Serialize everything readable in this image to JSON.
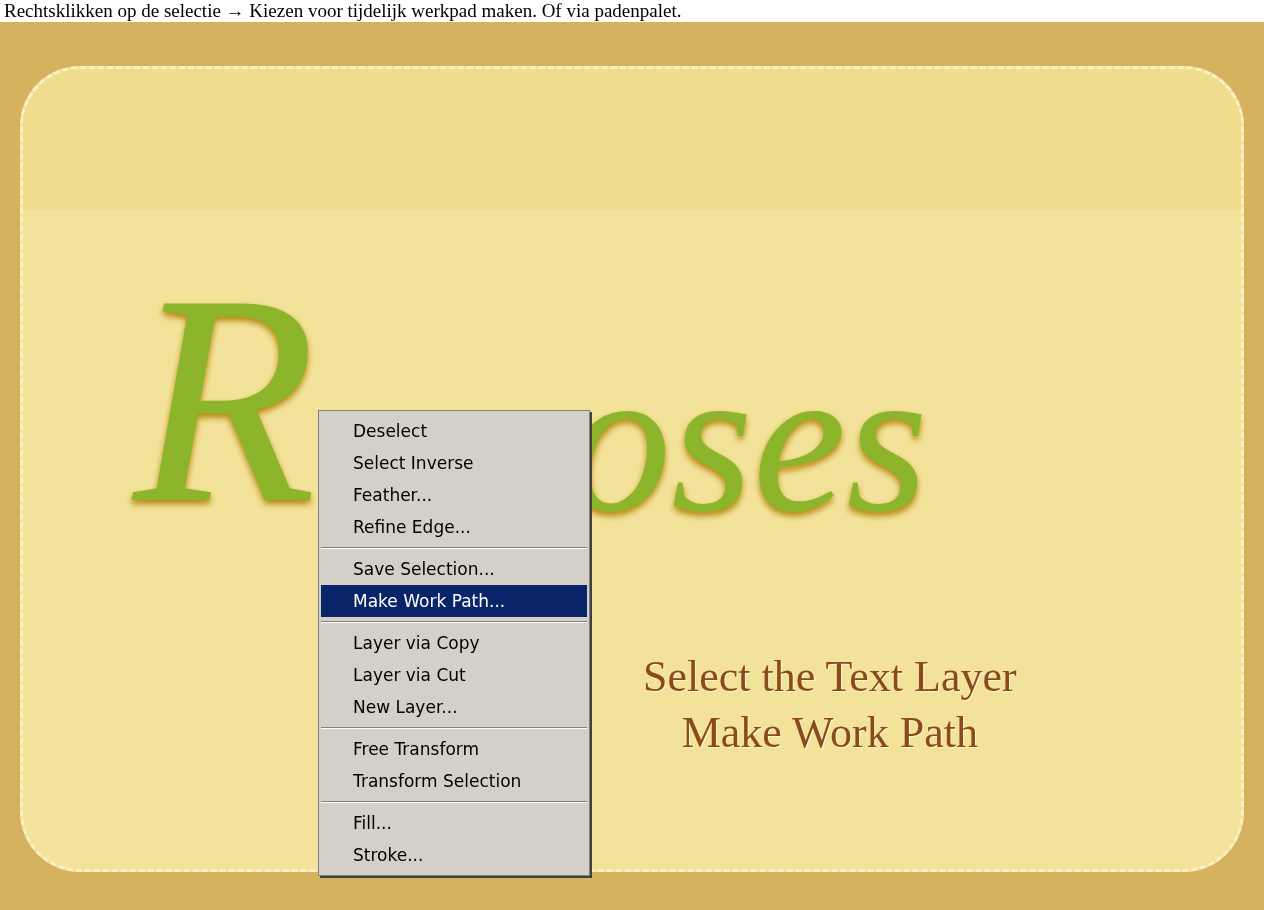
{
  "caption": "Rechtsklikken op de selectie → Kiezen voor tijdelijk werkpad maken. Of via padenpalet.",
  "canvas": {
    "title_letters": [
      "R",
      "oses"
    ],
    "instructions": [
      "Select the Text Layer",
      "Make Work Path"
    ]
  },
  "context_menu": {
    "items": [
      {
        "kind": "item",
        "label": "Deselect",
        "selected": false
      },
      {
        "kind": "item",
        "label": "Select Inverse",
        "selected": false
      },
      {
        "kind": "item",
        "label": "Feather...",
        "selected": false
      },
      {
        "kind": "item",
        "label": "Refine Edge...",
        "selected": false
      },
      {
        "kind": "separator"
      },
      {
        "kind": "item",
        "label": "Save Selection...",
        "selected": false
      },
      {
        "kind": "item",
        "label": "Make Work Path...",
        "selected": true
      },
      {
        "kind": "separator"
      },
      {
        "kind": "item",
        "label": "Layer via Copy",
        "selected": false
      },
      {
        "kind": "item",
        "label": "Layer via Cut",
        "selected": false
      },
      {
        "kind": "item",
        "label": "New Layer...",
        "selected": false
      },
      {
        "kind": "separator"
      },
      {
        "kind": "item",
        "label": "Free Transform",
        "selected": false
      },
      {
        "kind": "item",
        "label": "Transform Selection",
        "selected": false
      },
      {
        "kind": "separator"
      },
      {
        "kind": "item",
        "label": "Fill...",
        "selected": false
      },
      {
        "kind": "item",
        "label": "Stroke...",
        "selected": false
      }
    ]
  }
}
